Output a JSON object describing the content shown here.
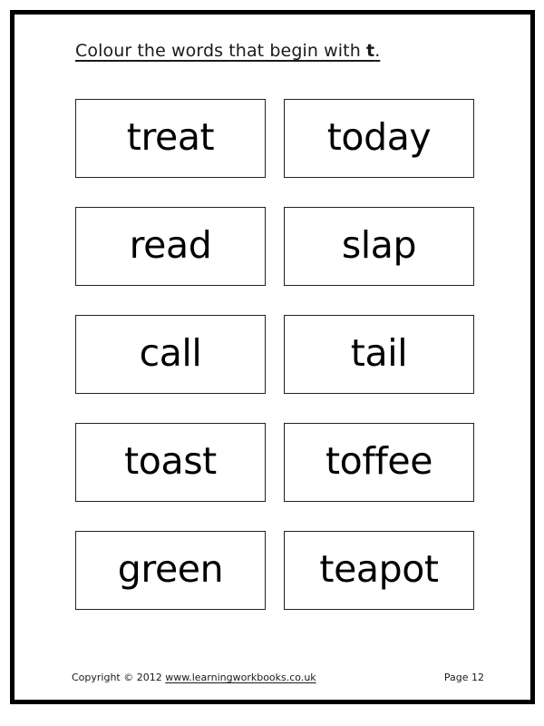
{
  "page": {
    "border_color": "#000000",
    "background_color": "#ffffff"
  },
  "instruction": {
    "prefix": "Colour the words that begin with ",
    "target_letter": "t",
    "suffix": "."
  },
  "word_grid": {
    "rows": [
      {
        "left": "treat",
        "right": "today"
      },
      {
        "left": "read",
        "right": "slap"
      },
      {
        "left": "call",
        "right": "tail"
      },
      {
        "left": "toast",
        "right": "toffee"
      },
      {
        "left": "green",
        "right": "teapot"
      }
    ]
  },
  "footer": {
    "copyright_prefix": "Copyright © 2012 ",
    "url": "www.learningworkbooks.co.uk",
    "page_label": "Page 12"
  }
}
